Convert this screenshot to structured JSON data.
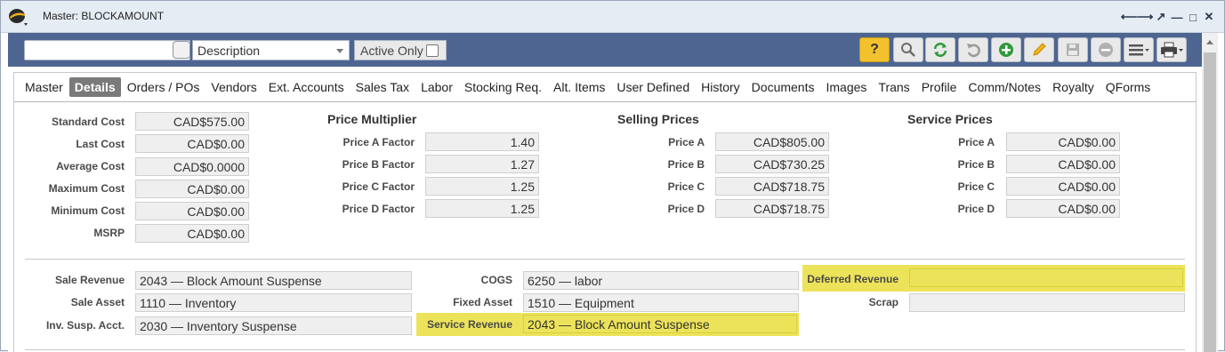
{
  "window": {
    "title": "Master: BLOCKAMOUNT"
  },
  "toolbar": {
    "search_value": "",
    "description_select": "Description",
    "active_only_label": "Active Only",
    "help_label": "?"
  },
  "tabs": [
    "Master",
    "Details",
    "Orders / POs",
    "Vendors",
    "Ext. Accounts",
    "Sales Tax",
    "Labor",
    "Stocking Req.",
    "Alt. Items",
    "User Defined",
    "History",
    "Documents",
    "Images",
    "Trans",
    "Profile",
    "Comm/Notes",
    "Royalty",
    "QForms"
  ],
  "active_tab": "Details",
  "costs": [
    {
      "label": "Standard Cost",
      "value": "CAD$575.00"
    },
    {
      "label": "Last Cost",
      "value": "CAD$0.00"
    },
    {
      "label": "Average Cost",
      "value": "CAD$0.0000"
    },
    {
      "label": "Maximum Cost",
      "value": "CAD$0.00"
    },
    {
      "label": "Minimum Cost",
      "value": "CAD$0.00"
    },
    {
      "label": "MSRP",
      "value": "CAD$0.00"
    }
  ],
  "price_multiplier": {
    "title": "Price Multiplier",
    "rows": [
      {
        "label": "Price A Factor",
        "value": "1.40"
      },
      {
        "label": "Price B Factor",
        "value": "1.27"
      },
      {
        "label": "Price C Factor",
        "value": "1.25"
      },
      {
        "label": "Price D Factor",
        "value": "1.25"
      }
    ]
  },
  "selling_prices": {
    "title": "Selling Prices",
    "rows": [
      {
        "label": "Price A",
        "value": "CAD$805.00"
      },
      {
        "label": "Price B",
        "value": "CAD$730.25"
      },
      {
        "label": "Price C",
        "value": "CAD$718.75"
      },
      {
        "label": "Price D",
        "value": "CAD$718.75"
      }
    ]
  },
  "service_prices": {
    "title": "Service Prices",
    "rows": [
      {
        "label": "Price A",
        "value": "CAD$0.00"
      },
      {
        "label": "Price B",
        "value": "CAD$0.00"
      },
      {
        "label": "Price C",
        "value": "CAD$0.00"
      },
      {
        "label": "Price D",
        "value": "CAD$0.00"
      }
    ]
  },
  "accounts": {
    "sale_revenue": {
      "label": "Sale Revenue",
      "value": "2043 — Block Amount Suspense"
    },
    "sale_asset": {
      "label": "Sale Asset",
      "value": "1110 — Inventory"
    },
    "inv_susp": {
      "label": "Inv. Susp. Acct.",
      "value": "2030 — Inventory Suspense"
    },
    "cogs": {
      "label": "COGS",
      "value": "6250 — labor"
    },
    "fixed_asset": {
      "label": "Fixed Asset",
      "value": "1510 — Equipment"
    },
    "service_revenue": {
      "label": "Service Revenue",
      "value": "2043 — Block Amount Suspense"
    },
    "deferred_revenue": {
      "label": "Deferred Revenue",
      "value": ""
    },
    "scrap": {
      "label": "Scrap",
      "value": ""
    }
  },
  "colors": {
    "toolbar": "#4d6590",
    "highlight": "#ece35a",
    "help_button": "#f3c12e"
  },
  "icons": [
    "app-logo-icon",
    "back-icon",
    "forward-icon",
    "popout-icon",
    "minimize-icon",
    "maximize-icon",
    "close-icon",
    "search-icon",
    "refresh-icon",
    "undo-icon",
    "add-icon",
    "edit-icon",
    "save-icon",
    "delete-icon",
    "menu-icon",
    "print-icon"
  ]
}
